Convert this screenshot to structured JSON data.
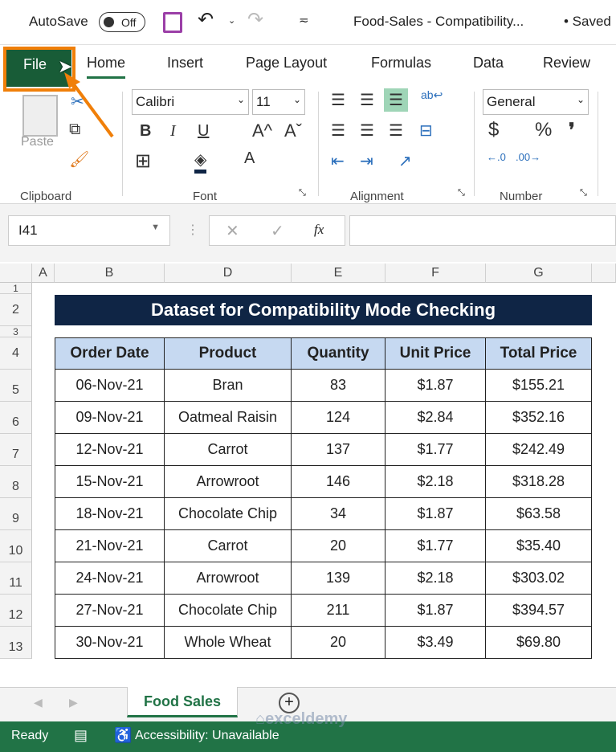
{
  "titlebar": {
    "autosave_label": "AutoSave",
    "autosave_state": "Off",
    "filename": "Food-Sales  -  Compatibility...",
    "saved": "• Saved"
  },
  "tabs": [
    "File",
    "Home",
    "Insert",
    "Page Layout",
    "Formulas",
    "Data",
    "Review"
  ],
  "ribbon": {
    "paste": "Paste",
    "font_name": "Calibri",
    "font_size": "11",
    "number_format": "General",
    "groups": [
      "Clipboard",
      "Font",
      "Alignment",
      "Number"
    ],
    "bold": "B",
    "italic": "I",
    "underline": "U",
    "grow": "A^",
    "shrink": "Aˇ",
    "font_color": "A",
    "currency": "$",
    "percent": "%",
    "comma": "❜"
  },
  "formula_bar": {
    "name_box": "I41",
    "fx": "fx",
    "value": ""
  },
  "columns": [
    "A",
    "B",
    "D",
    "E",
    "F",
    "G"
  ],
  "rows": [
    "1",
    "2",
    "3",
    "4",
    "5",
    "6",
    "7",
    "8",
    "9",
    "10",
    "11",
    "12",
    "13"
  ],
  "sheet": {
    "title": "Dataset for Compatibility Mode Checking",
    "headers": [
      "Order Date",
      "Product",
      "Quantity",
      "Unit Price",
      "Total Price"
    ],
    "data": [
      [
        "06-Nov-21",
        "Bran",
        "83",
        "$1.87",
        "$155.21"
      ],
      [
        "09-Nov-21",
        "Oatmeal Raisin",
        "124",
        "$2.84",
        "$352.16"
      ],
      [
        "12-Nov-21",
        "Carrot",
        "137",
        "$1.77",
        "$242.49"
      ],
      [
        "15-Nov-21",
        "Arrowroot",
        "146",
        "$2.18",
        "$318.28"
      ],
      [
        "18-Nov-21",
        "Chocolate Chip",
        "34",
        "$1.87",
        "$63.58"
      ],
      [
        "21-Nov-21",
        "Carrot",
        "20",
        "$1.77",
        "$35.40"
      ],
      [
        "24-Nov-21",
        "Arrowroot",
        "139",
        "$2.18",
        "$303.02"
      ],
      [
        "27-Nov-21",
        "Chocolate Chip",
        "211",
        "$1.87",
        "$394.57"
      ],
      [
        "30-Nov-21",
        "Whole Wheat",
        "20",
        "$3.49",
        "$69.80"
      ]
    ]
  },
  "sheet_tabs": [
    "Food Sales"
  ],
  "status": {
    "ready": "Ready",
    "accessibility": "Accessibility: Unavailable"
  },
  "watermark": "exceldemy",
  "colors": {
    "excel_green": "#217346",
    "file_tab": "#185c37",
    "highlight": "#f07f09",
    "title_fill": "#0f2545",
    "header_fill": "#c6d9f1"
  }
}
